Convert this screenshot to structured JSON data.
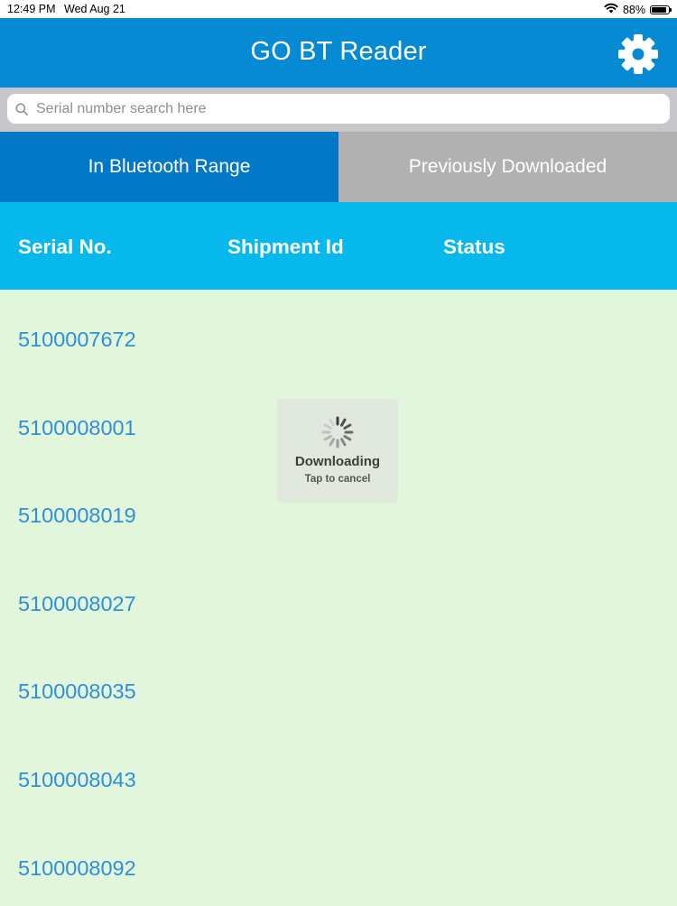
{
  "status_bar": {
    "time": "12:49 PM",
    "date": "Wed Aug 21",
    "battery_percent": "88%",
    "battery_level": 0.88,
    "wifi_icon": "wifi-icon",
    "battery_icon": "battery-icon"
  },
  "nav": {
    "title": "GO BT Reader",
    "settings_icon": "gear-icon"
  },
  "search": {
    "placeholder": "Serial number search here",
    "value": "",
    "icon": "search-icon"
  },
  "tabs": [
    {
      "label": "In Bluetooth Range",
      "active": true
    },
    {
      "label": "Previously Downloaded",
      "active": false
    }
  ],
  "table": {
    "columns": [
      "Serial No.",
      "Shipment Id",
      "Status"
    ],
    "rows": [
      {
        "serial": "5100007672",
        "shipment_id": "",
        "status": ""
      },
      {
        "serial": "5100008001",
        "shipment_id": "",
        "status": ""
      },
      {
        "serial": "5100008019",
        "shipment_id": "",
        "status": ""
      },
      {
        "serial": "5100008027",
        "shipment_id": "",
        "status": ""
      },
      {
        "serial": "5100008035",
        "shipment_id": "",
        "status": ""
      },
      {
        "serial": "5100008043",
        "shipment_id": "",
        "status": ""
      },
      {
        "serial": "5100008092",
        "shipment_id": "",
        "status": ""
      }
    ]
  },
  "overlay": {
    "title": "Downloading",
    "subtitle": "Tap to cancel",
    "icon": "spinner-icon"
  },
  "colors": {
    "nav_background": "#058ad3",
    "tab_active": "#0478c8",
    "tab_inactive": "#b1b1b1",
    "header_background": "#06b8ec",
    "list_background": "#e2f6db",
    "serial_text": "#2f8fd8"
  }
}
